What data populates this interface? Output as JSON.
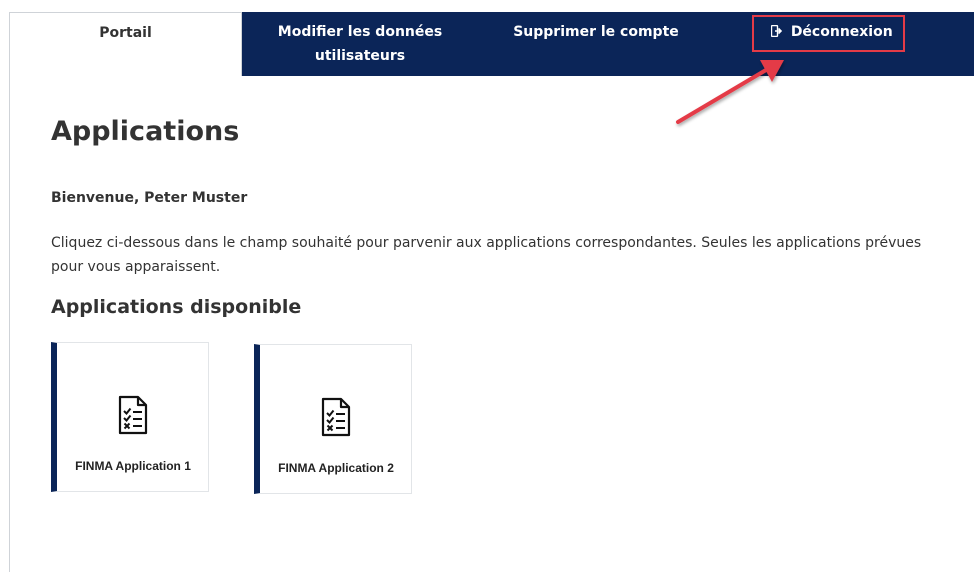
{
  "nav": {
    "tabs": [
      {
        "label": "Portail",
        "active": true
      },
      {
        "label": "Modifier les données utilisateurs",
        "active": false
      },
      {
        "label": "Supprimer le compte",
        "active": false
      }
    ],
    "logout_label": "Déconnexion",
    "logout_icon": "sign-out-icon"
  },
  "main": {
    "title": "Applications",
    "welcome": "Bienvenue, Peter Muster",
    "instructions": "Cliquez ci-dessous dans le champ souhaité pour parvenir aux applications correspondantes. Seules les applications prévues pour vous apparaissent.",
    "section_title": "Applications disponible",
    "apps": [
      {
        "label": "FINMA Application 1",
        "icon": "checklist-document-icon"
      },
      {
        "label": "FINMA Application 2",
        "icon": "checklist-document-icon"
      }
    ]
  },
  "colors": {
    "navbar": "#0b2558",
    "card_accent": "#0b2558",
    "annotation": "#e43b47"
  }
}
